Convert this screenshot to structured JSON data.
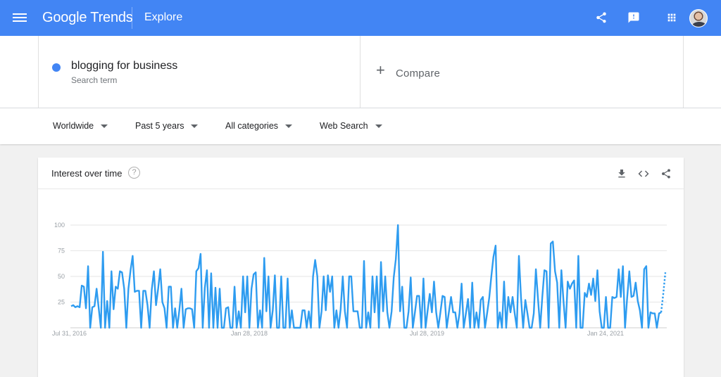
{
  "header": {
    "logo_google": "Google",
    "logo_trends": "Trends",
    "section": "Explore",
    "icons": [
      "menu-icon",
      "share-icon",
      "feedback-icon",
      "apps-icon",
      "avatar"
    ],
    "color": "#4285f4"
  },
  "search_terms": [
    {
      "term": "blogging for business",
      "subtitle": "Search term",
      "color": "#4285f4"
    }
  ],
  "compare": {
    "label": "Compare"
  },
  "filters": {
    "region": "Worldwide",
    "time": "Past 5 years",
    "category": "All categories",
    "property": "Web Search"
  },
  "card": {
    "title": "Interest over time",
    "help_symbol": "?",
    "icons": [
      "download-icon",
      "embed-icon",
      "share-icon"
    ]
  },
  "chart_data": {
    "type": "line",
    "title": "",
    "xlabel": "",
    "ylabel": "",
    "ylim": [
      0,
      100
    ],
    "yticks": [
      "100",
      "75",
      "50",
      "25"
    ],
    "xticks": [
      "Jul 31, 2016",
      "Jan 28, 2018",
      "Jul 28, 2019",
      "Jan 24, 2021"
    ],
    "grid": true,
    "partial_last_points": 3,
    "series": [
      {
        "color": "#4285f4",
        "values": [
          21,
          22,
          20,
          21,
          20,
          41,
          40,
          19,
          60,
          0,
          20,
          21,
          38,
          19,
          0,
          74,
          0,
          26,
          0,
          55,
          18,
          40,
          38,
          55,
          54,
          38,
          0,
          38,
          56,
          70,
          35,
          36,
          36,
          0,
          36,
          36,
          22,
          0,
          37,
          55,
          22,
          38,
          57,
          25,
          19,
          0,
          40,
          40,
          0,
          19,
          0,
          17,
          38,
          0,
          18,
          19,
          19,
          18,
          0,
          55,
          58,
          72,
          0,
          39,
          56,
          0,
          53,
          0,
          39,
          0,
          38,
          0,
          0,
          19,
          20,
          0,
          0,
          40,
          0,
          16,
          0,
          50,
          15,
          50,
          0,
          38,
          52,
          54,
          0,
          17,
          0,
          68,
          16,
          50,
          0,
          17,
          51,
          0,
          0,
          50,
          0,
          0,
          48,
          0,
          17,
          0,
          0,
          0,
          0,
          17,
          17,
          0,
          16,
          0,
          50,
          66,
          50,
          0,
          16,
          50,
          17,
          51,
          35,
          50,
          0,
          17,
          0,
          18,
          50,
          16,
          0,
          50,
          50,
          16,
          16,
          16,
          0,
          0,
          65,
          0,
          15,
          0,
          50,
          15,
          50,
          0,
          64,
          16,
          50,
          15,
          0,
          16,
          49,
          67,
          100,
          16,
          40,
          0,
          0,
          16,
          49,
          0,
          15,
          31,
          31,
          0,
          48,
          0,
          17,
          33,
          15,
          45,
          15,
          0,
          15,
          31,
          30,
          0,
          15,
          30,
          15,
          15,
          0,
          14,
          43,
          0,
          14,
          28,
          0,
          44,
          0,
          15,
          0,
          27,
          30,
          0,
          14,
          29,
          50,
          69,
          80,
          0,
          15,
          0,
          45,
          0,
          30,
          15,
          30,
          14,
          0,
          70,
          29,
          0,
          27,
          14,
          0,
          0,
          14,
          57,
          28,
          0,
          30,
          56,
          55,
          0,
          82,
          84,
          55,
          44,
          0,
          56,
          26,
          0,
          45,
          38,
          43,
          46,
          0,
          70,
          0,
          0,
          34,
          30,
          43,
          32,
          48,
          26,
          56,
          16,
          0,
          0,
          30,
          0,
          0,
          30,
          29,
          30,
          57,
          30,
          60,
          0,
          29,
          55,
          30,
          31,
          44,
          26,
          17,
          0,
          57,
          60,
          0,
          15,
          14,
          14,
          0,
          14,
          15,
          33,
          54
        ]
      }
    ]
  }
}
